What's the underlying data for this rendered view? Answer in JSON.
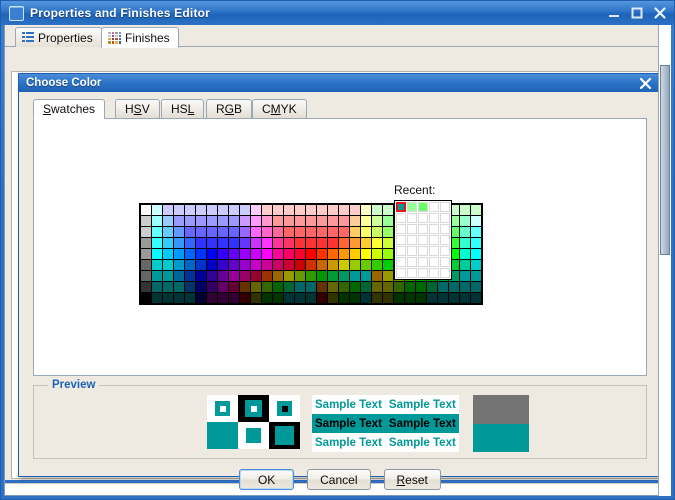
{
  "window": {
    "title": "Properties and Finishes Editor",
    "icon": "window-icon",
    "buttons": {
      "minimize": "minimize-icon",
      "maximize": "maximize-icon",
      "close": "close-icon"
    }
  },
  "tabs": [
    {
      "label": "Properties",
      "icon": "list-icon",
      "selected": false
    },
    {
      "label": "Finishes",
      "icon": "color-grid-icon",
      "selected": true
    }
  ],
  "dialog": {
    "title": "Choose Color",
    "close_icon": "close-icon",
    "tabs": [
      {
        "label": "Swatches",
        "mnemonic": "S",
        "selected": true
      },
      {
        "label": "HSV",
        "mnemonic": "V",
        "selected": false
      },
      {
        "label": "HSL",
        "mnemonic": "L",
        "selected": false
      },
      {
        "label": "RGB",
        "mnemonic": "G",
        "selected": false
      },
      {
        "label": "CMYK",
        "mnemonic": "M",
        "selected": false
      }
    ],
    "recent": {
      "label": "Recent:",
      "columns": 5,
      "rows": 7,
      "colors": [
        "#009999",
        "#99ff99",
        "#66ff66"
      ],
      "selected_index": 0,
      "selection_color": "#e01818",
      "empty_color": "#ffffff"
    },
    "preview": {
      "legend": "Preview",
      "sample_text": "Sample Text",
      "selected_color": "#009999",
      "swatch_top": "#747474",
      "swatch_bottom": "#009999",
      "text_color": "#009999",
      "highlight_bg": "#009999",
      "highlight_text": "#000000"
    },
    "buttons": [
      {
        "label": "OK",
        "mnemonic": "",
        "default": true
      },
      {
        "label": "Cancel",
        "mnemonic": "",
        "default": false
      },
      {
        "label": "Reset",
        "mnemonic": "R",
        "default": false
      }
    ]
  },
  "swatches": {
    "columns": 31,
    "rows": 9,
    "description": "Java Swing JColorChooser standard swatch palette",
    "grid": [
      [
        "#ffffff",
        "#ccffff",
        "#ccccff",
        "#ccccff",
        "#ccccff",
        "#ccccff",
        "#ccccff",
        "#ccccff",
        "#ccccff",
        "#ccccff",
        "#ffccff",
        "#ffcccc",
        "#ffcccc",
        "#ffcccc",
        "#ffcccc",
        "#ffcccc",
        "#ffcccc",
        "#ffcccc",
        "#ffcccc",
        "#ffcccc",
        "#ffffcc",
        "#ccffcc",
        "#ccffcc",
        "#ccffcc",
        "#ccffcc",
        "#ccffcc",
        "#ccffcc",
        "#ccffcc",
        "#ccffcc",
        "#ccffcc",
        "#ccffcc"
      ],
      [
        "#cccccc",
        "#99ffff",
        "#99ccff",
        "#9999ff",
        "#9999ff",
        "#9999ff",
        "#9999ff",
        "#9999ff",
        "#9999ff",
        "#cc99ff",
        "#ff99ff",
        "#ff99cc",
        "#ff9999",
        "#ff9999",
        "#ff9999",
        "#ff9999",
        "#ff9999",
        "#ff9999",
        "#ff9999",
        "#ffcc99",
        "#ffff99",
        "#ccff99",
        "#99ff99",
        "#99ff99",
        "#99ff99",
        "#99ff99",
        "#99ff99",
        "#99ff99",
        "#99ff99",
        "#99ffcc",
        "#ccffff"
      ],
      [
        "#cccccc",
        "#66ffff",
        "#66ccff",
        "#6699ff",
        "#6666ff",
        "#6666ff",
        "#6666ff",
        "#6666ff",
        "#6666ff",
        "#9966ff",
        "#ff66ff",
        "#ff66cc",
        "#ff6699",
        "#ff6666",
        "#ff6666",
        "#ff6666",
        "#ff6666",
        "#ff6666",
        "#ff6666",
        "#ffcc66",
        "#ffff66",
        "#ccff66",
        "#99ff66",
        "#66ff66",
        "#66ff66",
        "#66ff66",
        "#66ff66",
        "#66ff66",
        "#66ff66",
        "#66ffcc",
        "#66ffff"
      ],
      [
        "#999999",
        "#33ffff",
        "#33ccff",
        "#3399ff",
        "#3366ff",
        "#3333ff",
        "#3333ff",
        "#3333ff",
        "#3333ff",
        "#6633ff",
        "#cc33ff",
        "#ff33ff",
        "#ff3399",
        "#ff3366",
        "#ff3333",
        "#ff3333",
        "#ff3333",
        "#ff3333",
        "#ff6633",
        "#ff9933",
        "#ffcc33",
        "#ffff33",
        "#ccff33",
        "#99ff33",
        "#66ff33",
        "#33ff33",
        "#33ff33",
        "#33ff33",
        "#33ff33",
        "#33ffcc",
        "#33ffff"
      ],
      [
        "#999999",
        "#00ffff",
        "#00ccff",
        "#0099ff",
        "#0066ff",
        "#0033ff",
        "#0000ff",
        "#3300ff",
        "#6600ff",
        "#9900ff",
        "#cc00ff",
        "#ff00ff",
        "#ff0099",
        "#ff0066",
        "#ff0033",
        "#ff0000",
        "#ff3300",
        "#ff6600",
        "#ff9900",
        "#ffcc00",
        "#ffff00",
        "#ccff00",
        "#99ff00",
        "#66ff00",
        "#33ff00",
        "#00ff00",
        "#00ff00",
        "#00ff00",
        "#00ff00",
        "#00ffcc",
        "#00ffff"
      ],
      [
        "#666666",
        "#00cccc",
        "#00cccc",
        "#0099cc",
        "#0066cc",
        "#0033cc",
        "#0000cc",
        "#3300cc",
        "#6600cc",
        "#9900cc",
        "#cc00cc",
        "#cc0099",
        "#cc0066",
        "#cc0033",
        "#cc0000",
        "#cc3300",
        "#cc6600",
        "#cc9900",
        "#cccc00",
        "#99cc00",
        "#66cc00",
        "#33cc00",
        "#00cc00",
        "#00cc00",
        "#00cc00",
        "#00cc00",
        "#00cc00",
        "#00cc00",
        "#00cc33",
        "#00cc99",
        "#00cccc"
      ],
      [
        "#666666",
        "#009999",
        "#009999",
        "#006699",
        "#003399",
        "#000099",
        "#330099",
        "#660099",
        "#990099",
        "#990066",
        "#990033",
        "#993300",
        "#996600",
        "#999900",
        "#669900",
        "#339900",
        "#009900",
        "#009933",
        "#009966",
        "#009999",
        "#009999",
        "#996600",
        "#999900",
        "#669900",
        "#339900",
        "#009900",
        "#009900",
        "#009933",
        "#009966",
        "#009999",
        "#009999"
      ],
      [
        "#333333",
        "#006666",
        "#006666",
        "#006666",
        "#003366",
        "#000066",
        "#330066",
        "#660066",
        "#660033",
        "#663300",
        "#666600",
        "#336600",
        "#006600",
        "#006633",
        "#006666",
        "#006666",
        "#663300",
        "#666600",
        "#336600",
        "#006600",
        "#006633",
        "#666600",
        "#666600",
        "#336600",
        "#006600",
        "#006600",
        "#006633",
        "#006666",
        "#006666",
        "#006666",
        "#006666"
      ],
      [
        "#000000",
        "#003333",
        "#003333",
        "#003333",
        "#003333",
        "#000033",
        "#330033",
        "#330033",
        "#330033",
        "#330000",
        "#333300",
        "#003300",
        "#003300",
        "#003333",
        "#003333",
        "#003333",
        "#330000",
        "#333300",
        "#003300",
        "#003300",
        "#003333",
        "#333300",
        "#333300",
        "#003300",
        "#003300",
        "#003300",
        "#003333",
        "#003333",
        "#003333",
        "#003333",
        "#003333"
      ]
    ]
  },
  "scrollbar": {
    "orientation": "vertical",
    "name": "main-vertical-scrollbar"
  }
}
